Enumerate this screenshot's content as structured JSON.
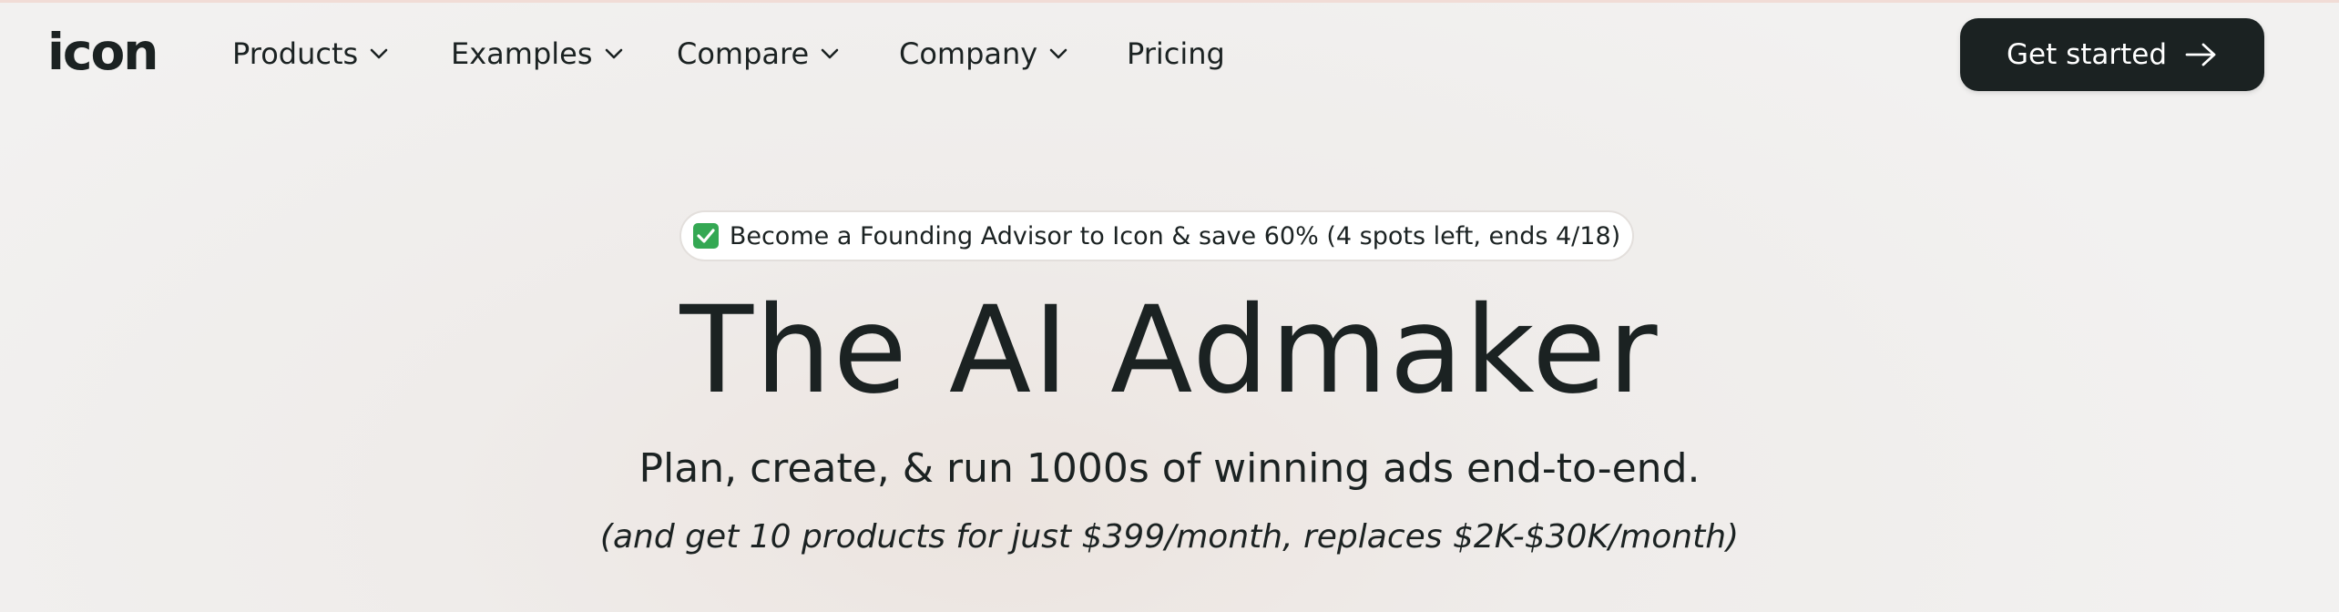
{
  "brand": {
    "logo_text": "icon"
  },
  "nav": {
    "items": [
      {
        "label": "Products",
        "has_dropdown": true
      },
      {
        "label": "Examples",
        "has_dropdown": true
      },
      {
        "label": "Compare",
        "has_dropdown": true
      },
      {
        "label": "Company",
        "has_dropdown": true
      },
      {
        "label": "Pricing",
        "has_dropdown": false
      }
    ]
  },
  "cta": {
    "label": "Get started",
    "icon": "arrow-right-icon"
  },
  "announcement": {
    "icon": "check-box-icon",
    "text": "Become a Founding Advisor to Icon & save 60% (4 spots left, ends 4/18)"
  },
  "hero": {
    "headline": "The AI Admaker",
    "subheadline": "Plan, create, & run 1000s of winning ads end-to-end.",
    "tagline": "(and get 10 products for just $399/month, replaces $2K-$30K/month)"
  },
  "colors": {
    "text": "#1b2222",
    "cta_background": "#1b2222",
    "check_green": "#34a853",
    "background": "#f0eeec"
  }
}
